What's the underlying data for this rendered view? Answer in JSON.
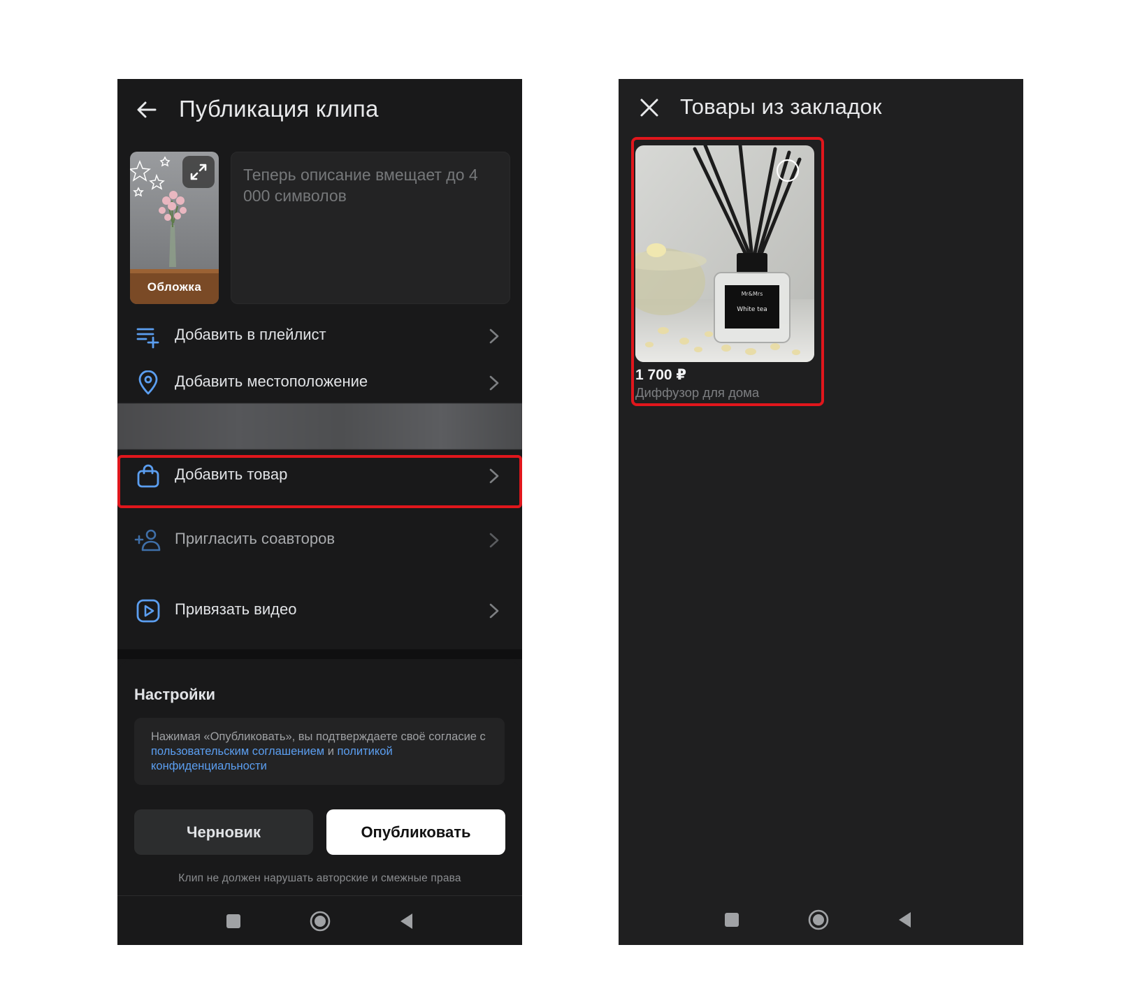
{
  "left_screen": {
    "title": "Публикация клипа",
    "cover_label": "Обложка",
    "description_placeholder": "Теперь описание вмещает до 4 000 символов",
    "rows": [
      {
        "label": "Добавить в плейлист",
        "icon": "playlist-add-icon"
      },
      {
        "label": "Добавить местоположение",
        "icon": "location-pin-icon"
      },
      {
        "label": "Добавить товар",
        "icon": "shopping-bag-icon"
      },
      {
        "label": "Пригласить соавторов",
        "icon": "add-person-icon"
      },
      {
        "label": "Привязать видео",
        "icon": "video-link-icon"
      }
    ],
    "settings": {
      "title": "Настройки",
      "terms_prefix": "Нажимая «Опубликовать», вы подтверждаете своё согласие с ",
      "terms_link_1": "пользовательским соглашением",
      "terms_mid": " и ",
      "terms_link_2": "политикой конфиденциальности"
    },
    "buttons": {
      "draft": "Черновик",
      "publish": "Опубликовать"
    },
    "footnote": "Клип не должен нарушать авторские и смежные права"
  },
  "right_screen": {
    "title": "Товары из закладок",
    "product": {
      "price": "1 700 ₽",
      "name": "Диффузор для дома",
      "bottle_brand": "Mr&Mrs",
      "bottle_label": "White tea"
    }
  },
  "colors": {
    "background": "#19191a",
    "accent_blue": "#5b9ef0",
    "highlight_red": "#e0161c",
    "text_primary": "#e1e3e6",
    "text_secondary": "#76787a"
  }
}
